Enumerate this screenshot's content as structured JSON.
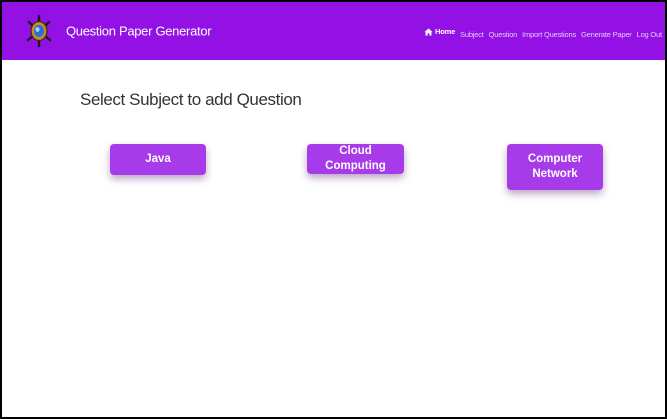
{
  "header": {
    "brand": "Question Paper Generator",
    "logo_icon": "turtle-logo-icon",
    "nav": [
      {
        "label": "Home",
        "icon": "home-icon",
        "active": true
      },
      {
        "label": "Subject",
        "active": false
      },
      {
        "label": "Question",
        "active": false
      },
      {
        "label": "Import Questions",
        "active": false
      },
      {
        "label": "Generate Paper",
        "active": false
      },
      {
        "label": "Log Out",
        "active": false
      }
    ]
  },
  "main": {
    "heading": "Select Subject to add Question",
    "subjects": [
      {
        "label": "Java"
      },
      {
        "label": "Cloud Computing"
      },
      {
        "label": "Computer Network"
      }
    ]
  },
  "colors": {
    "navbar": "#9311e4",
    "button": "#a73ae9",
    "nav_inactive_text": "#e6c9ff"
  }
}
